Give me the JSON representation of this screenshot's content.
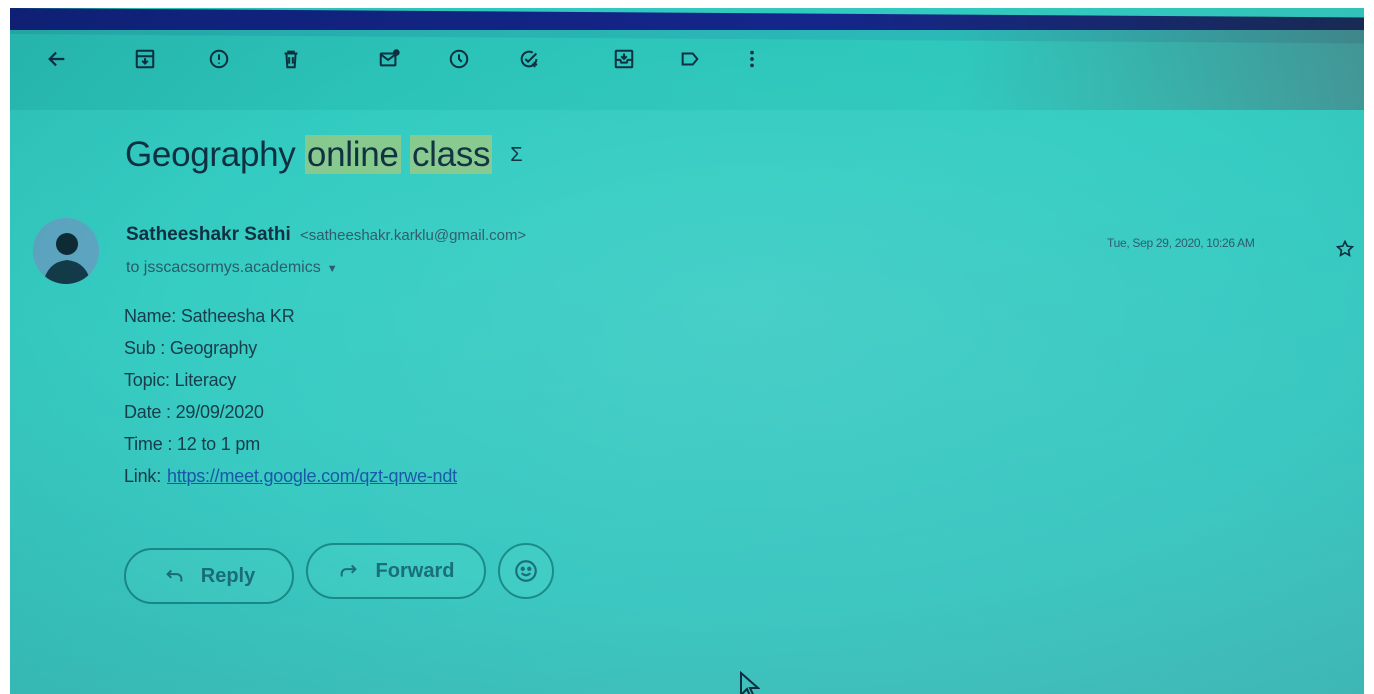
{
  "toolbar": {
    "icons": [
      "back-arrow-icon",
      "archive-icon",
      "report-spam-icon",
      "delete-icon",
      "mark-unread-icon",
      "snooze-icon",
      "add-to-tasks-icon",
      "move-to-icon",
      "label-icon",
      "more-options-icon"
    ]
  },
  "email": {
    "subject_prefix": "Geography",
    "subject_hl1": "online",
    "subject_hl2": "class",
    "important_marker": "Σ",
    "sender_name": "Satheeshakr Sathi",
    "sender_email": "<satheeshakr.karklu@gmail.com>",
    "to_label": "to jsscacsormys.academics",
    "date": "Tue, Sep 29, 2020, 10:26 AM",
    "body": {
      "name": "Name: Satheesha KR",
      "sub": "Sub : Geography",
      "topic": "Topic: Literacy",
      "date": "Date : 29/09/2020",
      "time": "Time : 12 to 1 pm",
      "link_label": "Link:",
      "link_url": "https://meet.google.com/qzt-qrwe-ndt"
    }
  },
  "actions": {
    "reply_label": "Reply",
    "forward_label": "Forward"
  },
  "colors": {
    "screen_tint": "#36cdc3",
    "highlight": "#86c98d",
    "link": "#1a57a8"
  }
}
